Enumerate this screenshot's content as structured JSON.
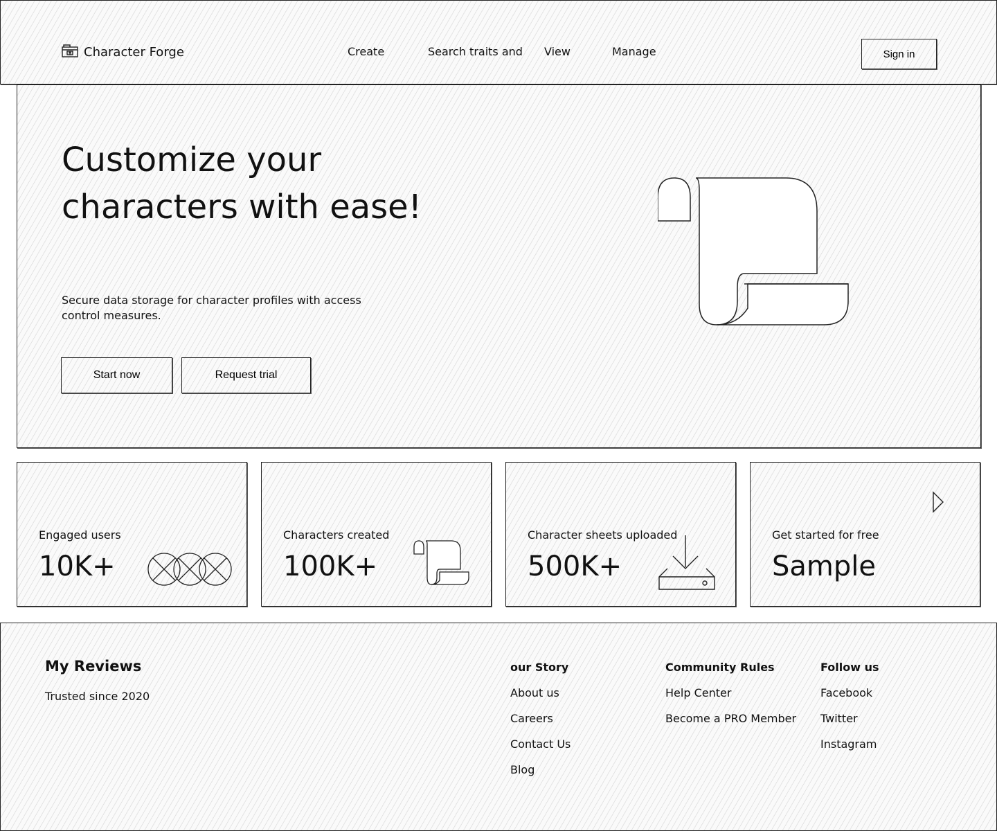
{
  "header": {
    "brand": "Character Forge",
    "brand_icon": "archive-icon",
    "nav": [
      {
        "label": "Create"
      },
      {
        "label": "Search traits and"
      },
      {
        "label": "View"
      },
      {
        "label": "Manage"
      }
    ],
    "signin_label": "Sign in"
  },
  "hero": {
    "title_line1": "Customize your",
    "title_line2": "characters with ease!",
    "subtitle": "Secure data storage for character profiles with access control measures.",
    "primary_button": "Start now",
    "secondary_button": "Request trial",
    "illustration": "scroll-icon"
  },
  "stats": [
    {
      "label": "Engaged users",
      "value": "10K+",
      "icon": "crossed-circles-icon"
    },
    {
      "label": "Characters created",
      "value": "100K+",
      "icon": "scroll-icon"
    },
    {
      "label": "Character sheets uploaded",
      "value": "500K+",
      "icon": "download-tray-icon"
    },
    {
      "label": "Get started for free",
      "value": "Sample",
      "icon": "play-arrow-icon"
    }
  ],
  "footer": {
    "title": "My Reviews",
    "tagline": "Trusted since 2020",
    "columns": [
      {
        "heading": "our Story",
        "links": [
          "About us",
          "Careers",
          "Contact Us",
          "Blog"
        ]
      },
      {
        "heading": "Community Rules",
        "links": [
          "Help Center",
          "Become a PRO Member"
        ]
      },
      {
        "heading": "Follow us",
        "links": [
          "Facebook",
          "Twitter",
          "Instagram"
        ]
      }
    ]
  }
}
